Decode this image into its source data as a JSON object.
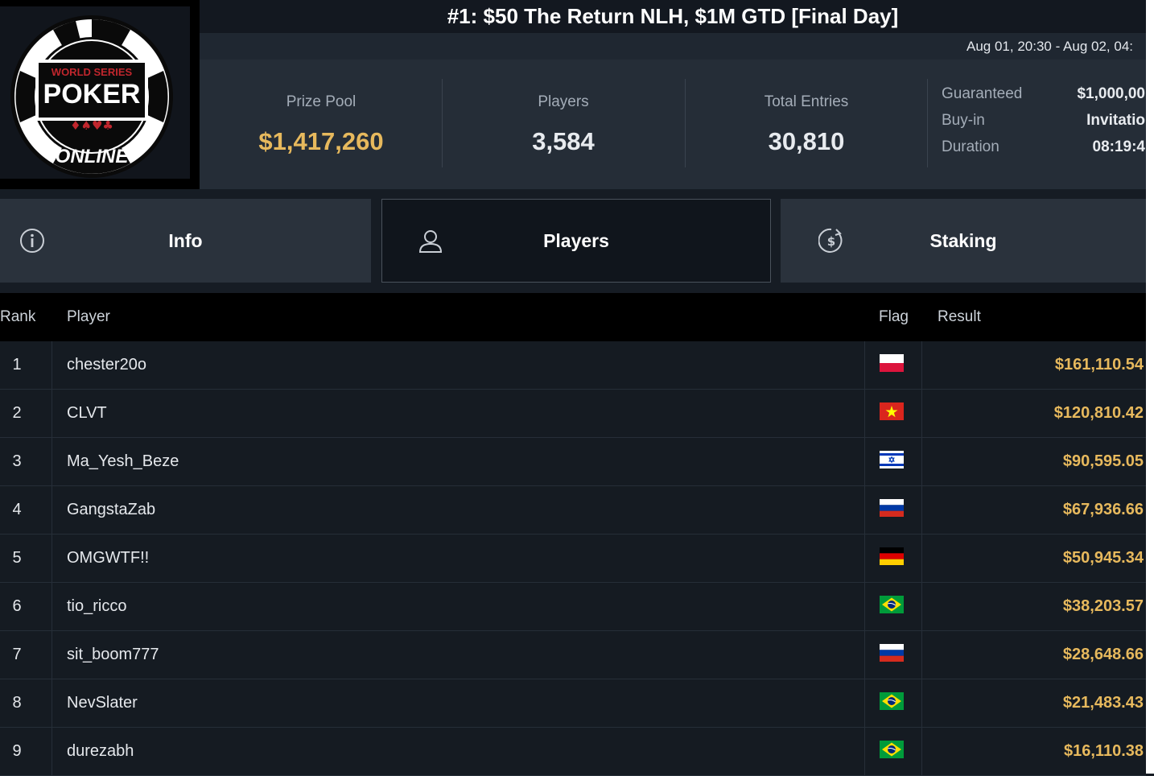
{
  "logo": {
    "top_text": "WORLD SERIES",
    "main_text": "POKER",
    "bottom_text": "ONLINE",
    "suits": "♦♠♥♣"
  },
  "header": {
    "title": "#1: $50 The Return NLH, $1M GTD [Final Day]",
    "dates": "Aug 01, 20:30 - Aug 02, 04:"
  },
  "stats": {
    "prize_pool_label": "Prize Pool",
    "prize_pool_value": "$1,417,260",
    "players_label": "Players",
    "players_value": "3,584",
    "entries_label": "Total Entries",
    "entries_value": "30,810"
  },
  "details": {
    "guaranteed_label": "Guaranteed",
    "guaranteed_value": "$1,000,00",
    "buyin_label": "Buy-in",
    "buyin_value": "Invitatio",
    "duration_label": "Duration",
    "duration_value": "08:19:4"
  },
  "tabs": [
    {
      "label": "Info",
      "icon": "info-icon"
    },
    {
      "label": "Players",
      "icon": "user-icon",
      "active": true
    },
    {
      "label": "Staking",
      "icon": "dollar-coin-icon"
    }
  ],
  "table": {
    "columns": {
      "rank": "Rank",
      "player": "Player",
      "flag": "Flag",
      "result": "Result"
    },
    "rows": [
      {
        "rank": "1",
        "player": "chester20o",
        "flag": "poland",
        "result": "$161,110.54"
      },
      {
        "rank": "2",
        "player": "CLVT",
        "flag": "vietnam",
        "result": "$120,810.42"
      },
      {
        "rank": "3",
        "player": "Ma_Yesh_Beze",
        "flag": "israel",
        "result": "$90,595.05"
      },
      {
        "rank": "4",
        "player": "GangstaZab",
        "flag": "russia",
        "result": "$67,936.66"
      },
      {
        "rank": "5",
        "player": "OMGWTF!!",
        "flag": "germany",
        "result": "$50,945.34"
      },
      {
        "rank": "6",
        "player": "tio_ricco",
        "flag": "brazil",
        "result": "$38,203.57"
      },
      {
        "rank": "7",
        "player": "sit_boom777",
        "flag": "russia",
        "result": "$28,648.66"
      },
      {
        "rank": "8",
        "player": "NevSlater",
        "flag": "brazil",
        "result": "$21,483.43"
      },
      {
        "rank": "9",
        "player": "durezabh",
        "flag": "brazil",
        "result": "$16,110.38"
      }
    ]
  },
  "colors": {
    "gold": "#e7b95d",
    "background": "#161c24"
  }
}
